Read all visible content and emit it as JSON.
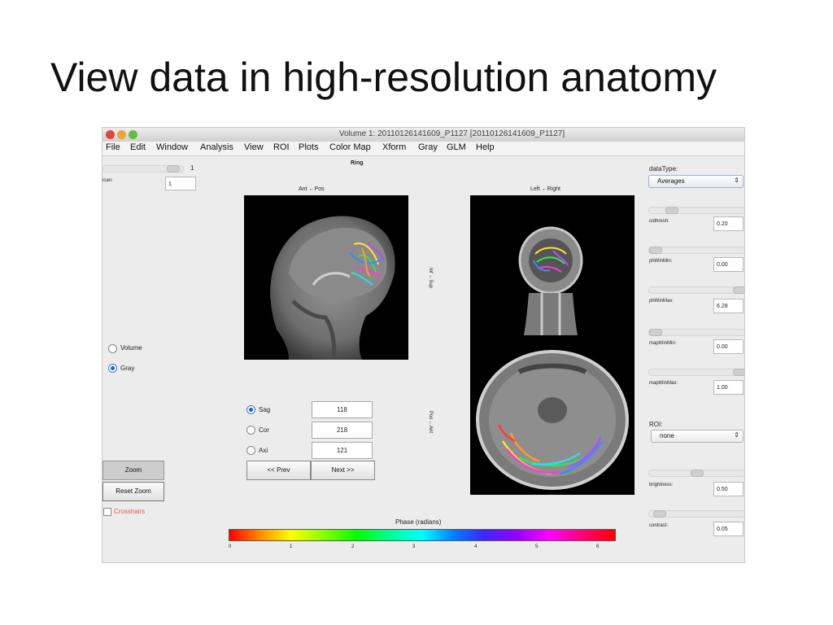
{
  "slide": {
    "title": "View data in high-resolution anatomy"
  },
  "window": {
    "title": "Volume 1: 20110126141609_P1127  [20110126141609_P1127]",
    "traffic_colors": [
      "#e2453c",
      "#e8a634",
      "#5fbf42"
    ]
  },
  "menubar": {
    "items": [
      "File",
      "Edit",
      "Window",
      "Analysis",
      "View",
      "ROI",
      "Plots",
      "Color Map",
      "Xform",
      "Gray",
      "GLM",
      "Help"
    ]
  },
  "left_panel": {
    "scan_slider_value": "1",
    "scan_label": "ican:",
    "scan_field": "1",
    "view_options": [
      {
        "label": "Volume",
        "selected": false
      },
      {
        "label": "Gray",
        "selected": true
      }
    ],
    "zoom_label": "Zoom",
    "reset_zoom_label": "Reset Zoom",
    "crosshairs_label": "Crosshairs",
    "crosshairs_checked": false
  },
  "center": {
    "header": "Ring",
    "sag_axis_label": "Ant ←Pos",
    "cor_axis_label": "Left ←Right",
    "inf_sup_label": "Inf ←Sup",
    "pos_ant_label": "Pos ←Ant",
    "slices": [
      {
        "label": "Sag",
        "value": "118",
        "selected": true
      },
      {
        "label": "Cor",
        "value": "218",
        "selected": false
      },
      {
        "label": "Axi",
        "value": "121",
        "selected": false
      }
    ],
    "prev_label": "<< Prev",
    "next_label": "Next >>"
  },
  "colorbar": {
    "title": "Phase (radians)",
    "ticks": [
      "0",
      "1",
      "2",
      "3",
      "4",
      "5",
      "6"
    ]
  },
  "right_panel": {
    "datatype_label": "dataType:",
    "datatype_value": "Averages",
    "params": [
      {
        "label": "cothresh:",
        "value": "0.20",
        "thumb": 0.2
      },
      {
        "label": "phWinMin:",
        "value": "0.00",
        "thumb": 0.0
      },
      {
        "label": "phWinMax:",
        "value": "6.28",
        "thumb": 1.0
      },
      {
        "label": "mapWinMin:",
        "value": "0.00",
        "thumb": 0.0
      },
      {
        "label": "mapWinMax:",
        "value": "1.00",
        "thumb": 1.0
      }
    ],
    "roi_label": "ROI:",
    "roi_value": "none",
    "brightness": {
      "label": "brightness:",
      "value": "0.50",
      "thumb": 0.5
    },
    "contrast": {
      "label": "contrast:",
      "value": "0.05",
      "thumb": 0.05
    }
  }
}
